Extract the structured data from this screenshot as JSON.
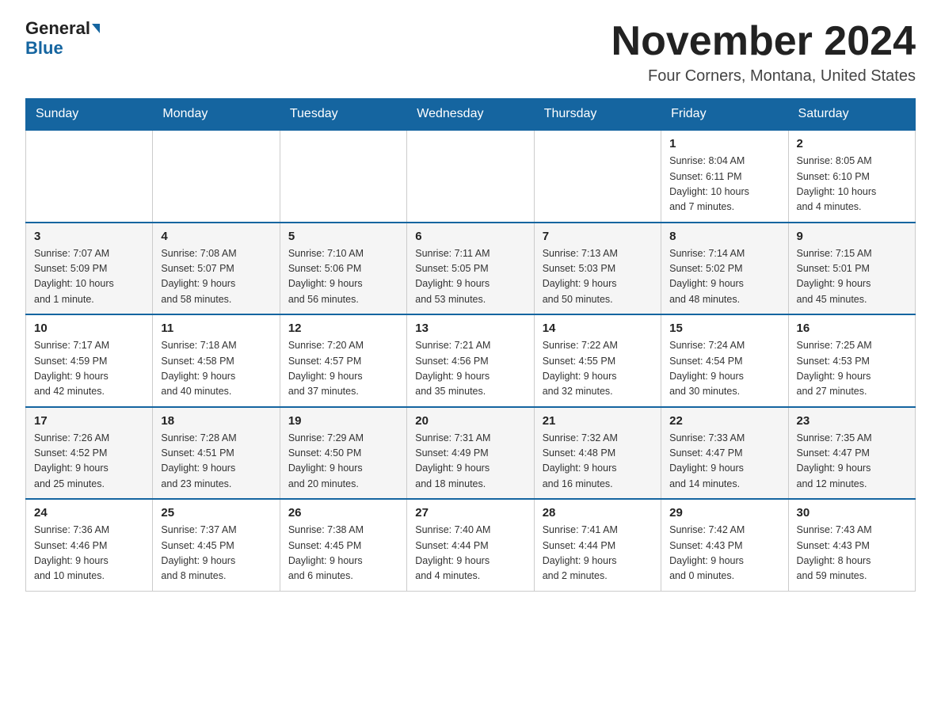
{
  "logo": {
    "general": "General",
    "blue": "Blue"
  },
  "header": {
    "month_year": "November 2024",
    "location": "Four Corners, Montana, United States"
  },
  "weekdays": [
    "Sunday",
    "Monday",
    "Tuesday",
    "Wednesday",
    "Thursday",
    "Friday",
    "Saturday"
  ],
  "weeks": [
    [
      {
        "day": "",
        "info": ""
      },
      {
        "day": "",
        "info": ""
      },
      {
        "day": "",
        "info": ""
      },
      {
        "day": "",
        "info": ""
      },
      {
        "day": "",
        "info": ""
      },
      {
        "day": "1",
        "info": "Sunrise: 8:04 AM\nSunset: 6:11 PM\nDaylight: 10 hours\nand 7 minutes."
      },
      {
        "day": "2",
        "info": "Sunrise: 8:05 AM\nSunset: 6:10 PM\nDaylight: 10 hours\nand 4 minutes."
      }
    ],
    [
      {
        "day": "3",
        "info": "Sunrise: 7:07 AM\nSunset: 5:09 PM\nDaylight: 10 hours\nand 1 minute."
      },
      {
        "day": "4",
        "info": "Sunrise: 7:08 AM\nSunset: 5:07 PM\nDaylight: 9 hours\nand 58 minutes."
      },
      {
        "day": "5",
        "info": "Sunrise: 7:10 AM\nSunset: 5:06 PM\nDaylight: 9 hours\nand 56 minutes."
      },
      {
        "day": "6",
        "info": "Sunrise: 7:11 AM\nSunset: 5:05 PM\nDaylight: 9 hours\nand 53 minutes."
      },
      {
        "day": "7",
        "info": "Sunrise: 7:13 AM\nSunset: 5:03 PM\nDaylight: 9 hours\nand 50 minutes."
      },
      {
        "day": "8",
        "info": "Sunrise: 7:14 AM\nSunset: 5:02 PM\nDaylight: 9 hours\nand 48 minutes."
      },
      {
        "day": "9",
        "info": "Sunrise: 7:15 AM\nSunset: 5:01 PM\nDaylight: 9 hours\nand 45 minutes."
      }
    ],
    [
      {
        "day": "10",
        "info": "Sunrise: 7:17 AM\nSunset: 4:59 PM\nDaylight: 9 hours\nand 42 minutes."
      },
      {
        "day": "11",
        "info": "Sunrise: 7:18 AM\nSunset: 4:58 PM\nDaylight: 9 hours\nand 40 minutes."
      },
      {
        "day": "12",
        "info": "Sunrise: 7:20 AM\nSunset: 4:57 PM\nDaylight: 9 hours\nand 37 minutes."
      },
      {
        "day": "13",
        "info": "Sunrise: 7:21 AM\nSunset: 4:56 PM\nDaylight: 9 hours\nand 35 minutes."
      },
      {
        "day": "14",
        "info": "Sunrise: 7:22 AM\nSunset: 4:55 PM\nDaylight: 9 hours\nand 32 minutes."
      },
      {
        "day": "15",
        "info": "Sunrise: 7:24 AM\nSunset: 4:54 PM\nDaylight: 9 hours\nand 30 minutes."
      },
      {
        "day": "16",
        "info": "Sunrise: 7:25 AM\nSunset: 4:53 PM\nDaylight: 9 hours\nand 27 minutes."
      }
    ],
    [
      {
        "day": "17",
        "info": "Sunrise: 7:26 AM\nSunset: 4:52 PM\nDaylight: 9 hours\nand 25 minutes."
      },
      {
        "day": "18",
        "info": "Sunrise: 7:28 AM\nSunset: 4:51 PM\nDaylight: 9 hours\nand 23 minutes."
      },
      {
        "day": "19",
        "info": "Sunrise: 7:29 AM\nSunset: 4:50 PM\nDaylight: 9 hours\nand 20 minutes."
      },
      {
        "day": "20",
        "info": "Sunrise: 7:31 AM\nSunset: 4:49 PM\nDaylight: 9 hours\nand 18 minutes."
      },
      {
        "day": "21",
        "info": "Sunrise: 7:32 AM\nSunset: 4:48 PM\nDaylight: 9 hours\nand 16 minutes."
      },
      {
        "day": "22",
        "info": "Sunrise: 7:33 AM\nSunset: 4:47 PM\nDaylight: 9 hours\nand 14 minutes."
      },
      {
        "day": "23",
        "info": "Sunrise: 7:35 AM\nSunset: 4:47 PM\nDaylight: 9 hours\nand 12 minutes."
      }
    ],
    [
      {
        "day": "24",
        "info": "Sunrise: 7:36 AM\nSunset: 4:46 PM\nDaylight: 9 hours\nand 10 minutes."
      },
      {
        "day": "25",
        "info": "Sunrise: 7:37 AM\nSunset: 4:45 PM\nDaylight: 9 hours\nand 8 minutes."
      },
      {
        "day": "26",
        "info": "Sunrise: 7:38 AM\nSunset: 4:45 PM\nDaylight: 9 hours\nand 6 minutes."
      },
      {
        "day": "27",
        "info": "Sunrise: 7:40 AM\nSunset: 4:44 PM\nDaylight: 9 hours\nand 4 minutes."
      },
      {
        "day": "28",
        "info": "Sunrise: 7:41 AM\nSunset: 4:44 PM\nDaylight: 9 hours\nand 2 minutes."
      },
      {
        "day": "29",
        "info": "Sunrise: 7:42 AM\nSunset: 4:43 PM\nDaylight: 9 hours\nand 0 minutes."
      },
      {
        "day": "30",
        "info": "Sunrise: 7:43 AM\nSunset: 4:43 PM\nDaylight: 8 hours\nand 59 minutes."
      }
    ]
  ]
}
